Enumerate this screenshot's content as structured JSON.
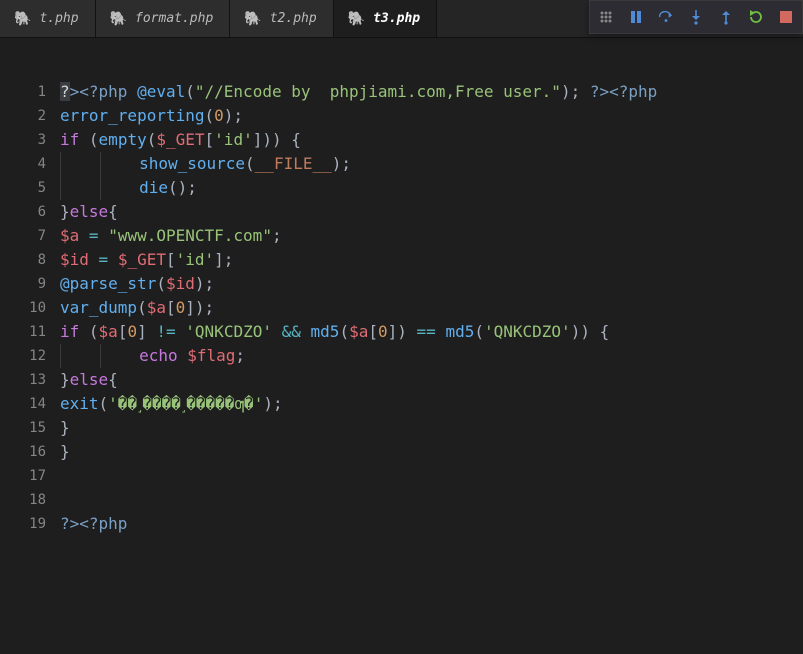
{
  "tabs": {
    "items": [
      {
        "label": "t.php",
        "active": false
      },
      {
        "label": "format.php",
        "active": false
      },
      {
        "label": "t2.php",
        "active": false
      },
      {
        "label": "t3.php",
        "active": true
      }
    ]
  },
  "debug_toolbar": {
    "icons": [
      "drag-handle-icon",
      "pause-icon",
      "step-over-icon",
      "step-into-icon",
      "step-out-icon",
      "restart-icon",
      "stop-icon"
    ]
  },
  "code": {
    "lines": [
      {
        "num": "1",
        "tokens": [
          [
            "cursor-mark",
            "?"
          ],
          [
            "t-phpopen",
            "><?php"
          ],
          [
            "t-plain",
            " "
          ],
          [
            "t-func",
            "@eval"
          ],
          [
            "t-punc",
            "("
          ],
          [
            "t-string",
            "\"//Encode by  phpjiami.com,Free user.\""
          ],
          [
            "t-punc",
            ");"
          ],
          [
            "t-plain",
            " "
          ],
          [
            "t-phpopen",
            "?><?php"
          ]
        ]
      },
      {
        "num": "2",
        "tokens": [
          [
            "t-func",
            "error_reporting"
          ],
          [
            "t-punc",
            "("
          ],
          [
            "t-num",
            "0"
          ],
          [
            "t-punc",
            ");"
          ]
        ]
      },
      {
        "num": "3",
        "tokens": [
          [
            "t-keyword",
            "if"
          ],
          [
            "t-plain",
            " "
          ],
          [
            "t-punc",
            "("
          ],
          [
            "t-func",
            "empty"
          ],
          [
            "t-punc",
            "("
          ],
          [
            "t-var",
            "$_GET"
          ],
          [
            "t-punc",
            "["
          ],
          [
            "t-string",
            "'id'"
          ],
          [
            "t-punc",
            "]))"
          ],
          [
            "t-plain",
            " "
          ],
          [
            "t-punc",
            "{"
          ]
        ]
      },
      {
        "num": "4",
        "indent": 2,
        "tokens": [
          [
            "t-func",
            "show_source"
          ],
          [
            "t-punc",
            "("
          ],
          [
            "t-magic",
            "__FILE__"
          ],
          [
            "t-punc",
            ");"
          ]
        ]
      },
      {
        "num": "5",
        "indent": 2,
        "tokens": [
          [
            "t-func",
            "die"
          ],
          [
            "t-punc",
            "();"
          ]
        ]
      },
      {
        "num": "6",
        "tokens": [
          [
            "t-punc",
            "}"
          ],
          [
            "t-keyword",
            "else"
          ],
          [
            "t-punc",
            "{"
          ]
        ]
      },
      {
        "num": "7",
        "tokens": [
          [
            "t-var",
            "$a"
          ],
          [
            "t-plain",
            " "
          ],
          [
            "t-op",
            "="
          ],
          [
            "t-plain",
            " "
          ],
          [
            "t-string",
            "\"www.OPENCTF.com\""
          ],
          [
            "t-punc",
            ";"
          ]
        ]
      },
      {
        "num": "8",
        "tokens": [
          [
            "t-var",
            "$id"
          ],
          [
            "t-plain",
            " "
          ],
          [
            "t-op",
            "="
          ],
          [
            "t-plain",
            " "
          ],
          [
            "t-var",
            "$_GET"
          ],
          [
            "t-punc",
            "["
          ],
          [
            "t-string",
            "'id'"
          ],
          [
            "t-punc",
            "];"
          ]
        ]
      },
      {
        "num": "9",
        "tokens": [
          [
            "t-func",
            "@parse_str"
          ],
          [
            "t-punc",
            "("
          ],
          [
            "t-var",
            "$id"
          ],
          [
            "t-punc",
            ");"
          ]
        ]
      },
      {
        "num": "10",
        "tokens": [
          [
            "t-func",
            "var_dump"
          ],
          [
            "t-punc",
            "("
          ],
          [
            "t-var",
            "$a"
          ],
          [
            "t-punc",
            "["
          ],
          [
            "t-num",
            "0"
          ],
          [
            "t-punc",
            "]);"
          ]
        ]
      },
      {
        "num": "11",
        "tokens": [
          [
            "t-keyword",
            "if"
          ],
          [
            "t-plain",
            " "
          ],
          [
            "t-punc",
            "("
          ],
          [
            "t-var",
            "$a"
          ],
          [
            "t-punc",
            "["
          ],
          [
            "t-num",
            "0"
          ],
          [
            "t-punc",
            "]"
          ],
          [
            "t-plain",
            " "
          ],
          [
            "t-op",
            "!="
          ],
          [
            "t-plain",
            " "
          ],
          [
            "t-string",
            "'QNKCDZO'"
          ],
          [
            "t-plain",
            " "
          ],
          [
            "t-op",
            "&&"
          ],
          [
            "t-plain",
            " "
          ],
          [
            "t-func",
            "md5"
          ],
          [
            "t-punc",
            "("
          ],
          [
            "t-var",
            "$a"
          ],
          [
            "t-punc",
            "["
          ],
          [
            "t-num",
            "0"
          ],
          [
            "t-punc",
            "])"
          ],
          [
            "t-plain",
            " "
          ],
          [
            "t-op",
            "=="
          ],
          [
            "t-plain",
            " "
          ],
          [
            "t-func",
            "md5"
          ],
          [
            "t-punc",
            "("
          ],
          [
            "t-string",
            "'QNKCDZO'"
          ],
          [
            "t-punc",
            "))"
          ],
          [
            "t-plain",
            " "
          ],
          [
            "t-punc",
            "{"
          ]
        ]
      },
      {
        "num": "12",
        "indent": 2,
        "tokens": [
          [
            "t-keyword",
            "echo"
          ],
          [
            "t-plain",
            " "
          ],
          [
            "t-var",
            "$flag"
          ],
          [
            "t-punc",
            ";"
          ]
        ]
      },
      {
        "num": "13",
        "tokens": [
          [
            "t-punc",
            "}"
          ],
          [
            "t-keyword",
            "else"
          ],
          [
            "t-punc",
            "{"
          ]
        ]
      },
      {
        "num": "14",
        "tokens": [
          [
            "t-func",
            "exit"
          ],
          [
            "t-punc",
            "("
          ],
          [
            "t-string",
            "'��˼����˼�����ƣ�'"
          ],
          [
            "t-punc",
            ");"
          ]
        ]
      },
      {
        "num": "15",
        "tokens": [
          [
            "t-punc",
            "}"
          ]
        ]
      },
      {
        "num": "16",
        "tokens": [
          [
            "t-punc",
            "}"
          ]
        ]
      },
      {
        "num": "17",
        "tokens": []
      },
      {
        "num": "18",
        "tokens": []
      },
      {
        "num": "19",
        "tokens": [
          [
            "t-phpopen",
            "?><?php"
          ]
        ]
      }
    ]
  }
}
